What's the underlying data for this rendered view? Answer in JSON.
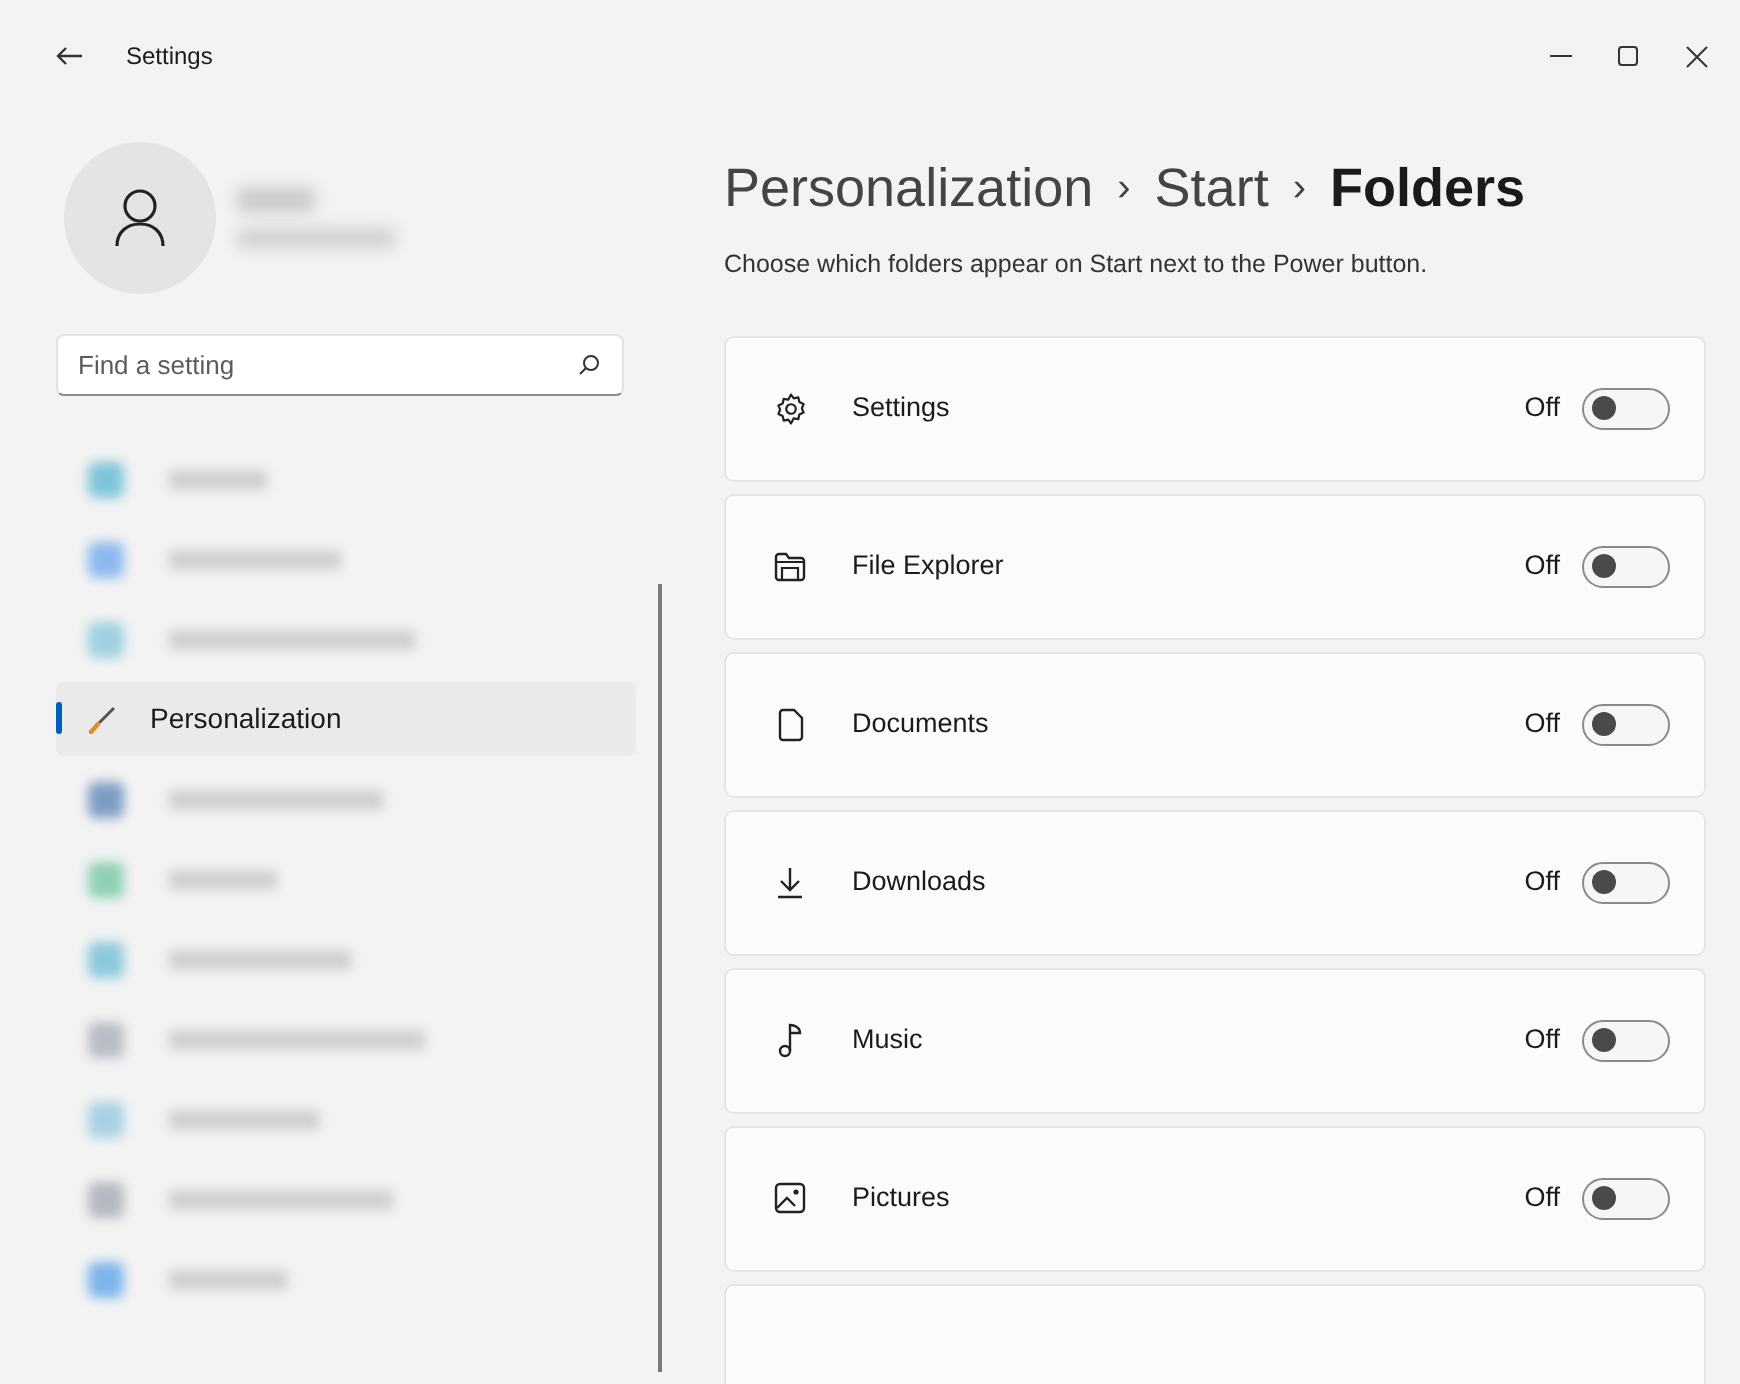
{
  "window": {
    "title": "Settings"
  },
  "search": {
    "placeholder": "Find a setting"
  },
  "sidebar": {
    "items": [
      {
        "kind": "blurred",
        "color": "#7fc4d8",
        "selected": false
      },
      {
        "kind": "blurred",
        "color": "#8cb8f0",
        "selected": false
      },
      {
        "kind": "blurred",
        "color": "#9ed0e0",
        "selected": false
      },
      {
        "kind": "item",
        "label": "Personalization",
        "selected": true
      },
      {
        "kind": "blurred",
        "color": "#7d9cc4",
        "selected": false
      },
      {
        "kind": "blurred",
        "color": "#8fd0b4",
        "selected": false
      },
      {
        "kind": "blurred",
        "color": "#8cc8dc",
        "selected": false
      },
      {
        "kind": "blurred",
        "color": "#b8bcc4",
        "selected": false
      },
      {
        "kind": "blurred",
        "color": "#a8d0e4",
        "selected": false
      },
      {
        "kind": "blurred",
        "color": "#b4b8c0",
        "selected": false
      },
      {
        "kind": "blurred",
        "color": "#7cb4ec",
        "selected": false
      }
    ]
  },
  "breadcrumb": [
    {
      "label": "Personalization",
      "current": false
    },
    {
      "label": "›",
      "kind": "sep"
    },
    {
      "label": "Start",
      "current": false
    },
    {
      "label": "›",
      "kind": "sep"
    },
    {
      "label": "Folders",
      "current": true
    }
  ],
  "description": "Choose which folders appear on Start next to the Power button.",
  "folders": [
    {
      "kind": "toggle",
      "label": "Settings",
      "state": "Off",
      "on": false
    },
    {
      "kind": "toggle",
      "label": "File Explorer",
      "state": "Off",
      "on": false
    },
    {
      "kind": "toggle",
      "label": "Documents",
      "state": "Off",
      "on": false
    },
    {
      "kind": "toggle",
      "label": "Downloads",
      "state": "Off",
      "on": false
    },
    {
      "kind": "toggle",
      "label": "Music",
      "state": "Off",
      "on": false
    },
    {
      "kind": "toggle",
      "label": "Pictures",
      "state": "Off",
      "on": false
    },
    {
      "kind": "partial"
    }
  ]
}
